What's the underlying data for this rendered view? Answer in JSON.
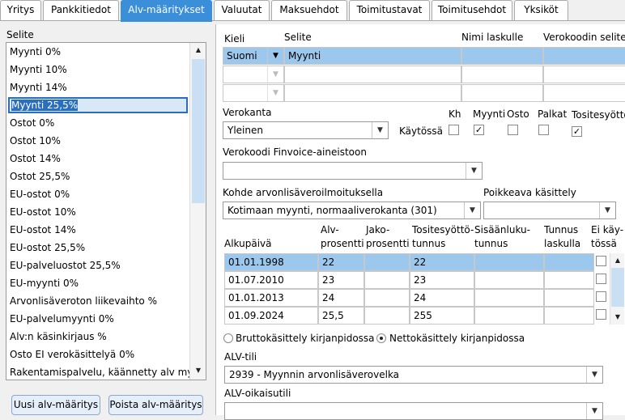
{
  "tabs": [
    "Yritys",
    "Pankkitiedot",
    "Alv-määritykset",
    "Valuutat",
    "Maksuehdot",
    "Toimitustavat",
    "Toimitusehdot",
    "Yksiköt"
  ],
  "left": {
    "header": "Selite",
    "items": [
      "Myynti 0%",
      "Myynti 10%",
      "Myynti 14%",
      "Myynti 25,5%",
      "Ostot 0%",
      "Ostot 10%",
      "Ostot 14%",
      "Ostot 25,5%",
      "EU-ostot 0%",
      "EU-ostot 10%",
      "EU-ostot 14%",
      "EU-ostot 25,5%",
      "EU-palveluostot 25,5%",
      "EU-myynti 0%",
      "Arvonlisäveroton liikevaihto %",
      "EU-palvelumyynti 0%",
      "Alv:n käsinkirjaus %",
      "Osto EI verokäsittelyä 0%",
      "Rakentamispalvelu, käännetty alv myy"
    ],
    "selected_index": 3,
    "add_button": "Uusi alv-määritys",
    "delete_button": "Poista alv-määritys"
  },
  "lang_table": {
    "headers": [
      "Kieli",
      "Selite",
      "Nimi laskulle",
      "Verokoodin selite"
    ],
    "row1": {
      "kieli": "Suomi",
      "selite": "Myynti"
    }
  },
  "verokanta": {
    "label": "Verokanta",
    "value": "Yleinen",
    "kaytossa": "Käytössä"
  },
  "flags": {
    "kh": "Kh",
    "myynti": "Myynti",
    "osto": "Osto",
    "palkat": "Palkat",
    "tositesyotto": "Tositesyöttö"
  },
  "finvoice": {
    "label": "Verokoodi Finvoice-aineistoon",
    "value": ""
  },
  "kohde": {
    "label": "Kohde arvonlisäveroilmoituksella",
    "value": "Kotimaan myynti, normaaliverokanta (301)"
  },
  "poikkeava": {
    "label": "Poikkeava käsittely",
    "value": ""
  },
  "rates": {
    "headers": {
      "alkupaiva": "Alkupäivä",
      "alv1": "Alv-",
      "alv2": "prosentti",
      "jako1": "Jako-",
      "jako2": "prosentti",
      "tos1": "Tositesyöttö-",
      "tos2": "tunnus",
      "sis1": "Sisäänluku-",
      "sis2": "tunnus",
      "tun1": "Tunnus",
      "tun2": "laskulla",
      "ei1": "Ei käy-",
      "ei2": "tössä"
    },
    "rows": [
      {
        "date": "01.01.1998",
        "alv": "22",
        "tos": "22"
      },
      {
        "date": "01.07.2010",
        "alv": "23",
        "tos": "23"
      },
      {
        "date": "01.01.2013",
        "alv": "24",
        "tos": "24"
      },
      {
        "date": "01.09.2024",
        "alv": "25,5",
        "tos": "255"
      }
    ]
  },
  "kasittely": {
    "brutto": "Bruttokäsittely kirjanpidossa",
    "netto": "Nettokäsittely kirjanpidossa"
  },
  "alvtili": {
    "label": "ALV-tili",
    "value": "2939 - Myynnin arvonlisäverovelka"
  },
  "alvoikaisutili": {
    "label": "ALV-oikaisutili",
    "value": ""
  }
}
